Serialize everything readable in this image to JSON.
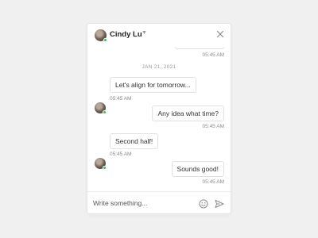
{
  "header": {
    "contact_name": "Cindy Lu",
    "icons": {
      "avatar": "avatar-photo",
      "dropdown": "chevron-down-icon",
      "close": "close-icon"
    }
  },
  "messages": {
    "previous_time": "05:45 AM",
    "date_separator": "JAN 21, 2021",
    "items": [
      {
        "from": "contact",
        "text": "Let's align for tomorrow...",
        "time": "05:45 AM"
      },
      {
        "from": "me",
        "text": "Any idea what time?",
        "time": "05:45 AM"
      },
      {
        "from": "contact",
        "text": "Second half!",
        "time": "05:45 AM"
      },
      {
        "from": "me",
        "text": "Sounds good!",
        "time": "05:45 AM"
      }
    ]
  },
  "composer": {
    "placeholder": "Write something...",
    "value": "",
    "icons": {
      "emoji": "smiley-icon",
      "send": "send-icon"
    }
  },
  "colors": {
    "background": "#f0f0f1",
    "panel": "#ffffff",
    "bubble_border": "#e1e1e3",
    "online": "#2ec55a",
    "text": "#333333",
    "muted": "#8a8a8f"
  }
}
